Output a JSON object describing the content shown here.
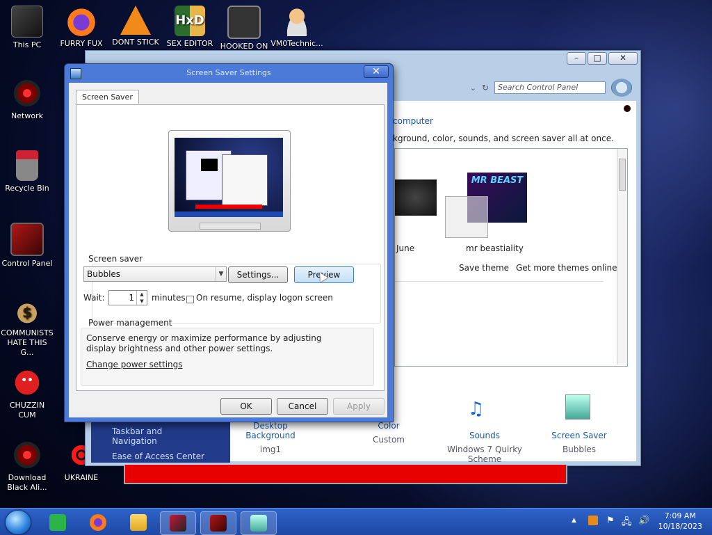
{
  "desktop": {
    "icons": [
      {
        "label": "This PC"
      },
      {
        "label": "FURRY FUX"
      },
      {
        "label": "DONT STICK"
      },
      {
        "label": "SEX EDITOR"
      },
      {
        "label": "HOOKED ON"
      },
      {
        "label": "VM0Technic..."
      },
      {
        "label": "Network"
      },
      {
        "label": "Recycle Bin"
      },
      {
        "label": "Control Panel"
      },
      {
        "label": "COMMUNISTS HATE THIS G..."
      },
      {
        "label": "CHUZZIN CUM"
      },
      {
        "label": "Download Black Ali..."
      },
      {
        "label": "UKRAINE"
      }
    ]
  },
  "personalization": {
    "search_placeholder": "Search Control Panel",
    "heading": "computer",
    "subheading": "kground, color, sounds, and screen saver all at once.",
    "theme_june": "June",
    "theme_beast": "mr beastiality",
    "thumb_text": "MR BEAST",
    "save_theme": "Save theme",
    "more_themes": "Get more themes online",
    "left_links": [
      "Taskbar and Navigation",
      "Ease of Access Center"
    ],
    "bottom": [
      {
        "title": "Desktop Background",
        "value": "img1"
      },
      {
        "title": "Color",
        "value": "Custom"
      },
      {
        "title": "Sounds",
        "value": "Windows 7 Quirky Scheme"
      },
      {
        "title": "Screen Saver",
        "value": "Bubbles"
      }
    ]
  },
  "dialog": {
    "title": "Screen Saver Settings",
    "tab": "Screen Saver",
    "screensaver_group": "Screen saver",
    "selected_saver": "Bubbles",
    "settings_btn": "Settings...",
    "preview_btn": "Preview",
    "wait_label": "Wait:",
    "wait_value": "1",
    "minutes_label": "minutes",
    "resume_label": "On resume, display logon screen",
    "power_group": "Power management",
    "power_text": "Conserve energy or maximize performance by adjusting display brightness and other power settings.",
    "power_link": "Change power settings",
    "ok": "OK",
    "cancel": "Cancel",
    "apply": "Apply"
  },
  "taskbar": {
    "time": "7:09 AM",
    "date": "10/18/2023"
  }
}
